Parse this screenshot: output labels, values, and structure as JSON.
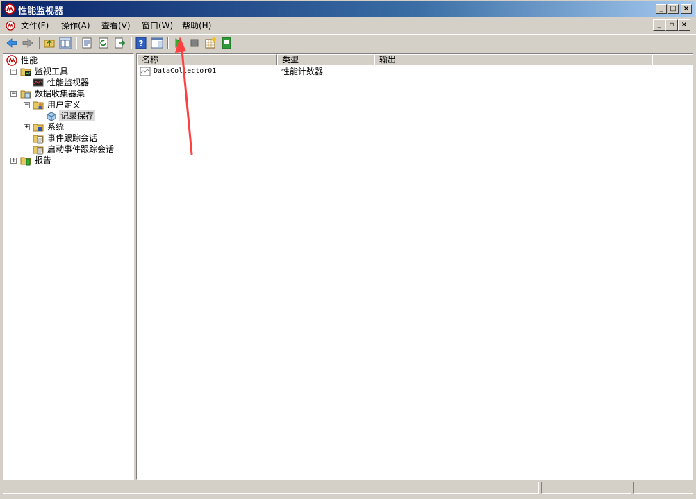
{
  "window": {
    "title": "性能监视器"
  },
  "menu": {
    "items": [
      "文件(F)",
      "操作(A)",
      "查看(V)",
      "窗口(W)",
      "帮助(H)"
    ]
  },
  "tree": {
    "root": "性能",
    "monitoring_tools": "监视工具",
    "perf_monitor": "性能监视器",
    "data_collector_sets": "数据收集器集",
    "user_defined": "用户定义",
    "record_save": "记录保存",
    "system": "系统",
    "event_trace": "事件跟踪会话",
    "startup_event_trace": "启动事件跟踪会话",
    "reports": "报告"
  },
  "list": {
    "columns": [
      "名称",
      "类型",
      "输出"
    ],
    "rows": [
      {
        "name": "DataCollector01",
        "type": "性能计数器",
        "output": ""
      }
    ]
  },
  "toolbar": {
    "icons": [
      "back-icon",
      "forward-icon",
      "up-folder-icon",
      "show-hide-tree-icon",
      "properties-icon",
      "refresh-icon",
      "export-icon",
      "help-icon",
      "show-action-pane-icon",
      "start-icon",
      "stop-icon",
      "new-icon",
      "save-template-icon"
    ]
  },
  "colors": {
    "title_gradient_start": "#0a246a",
    "title_gradient_end": "#a6caf0",
    "chrome": "#d4d0c8",
    "annotation_arrow": "#ff4040",
    "start_green": "#2fae2f"
  }
}
